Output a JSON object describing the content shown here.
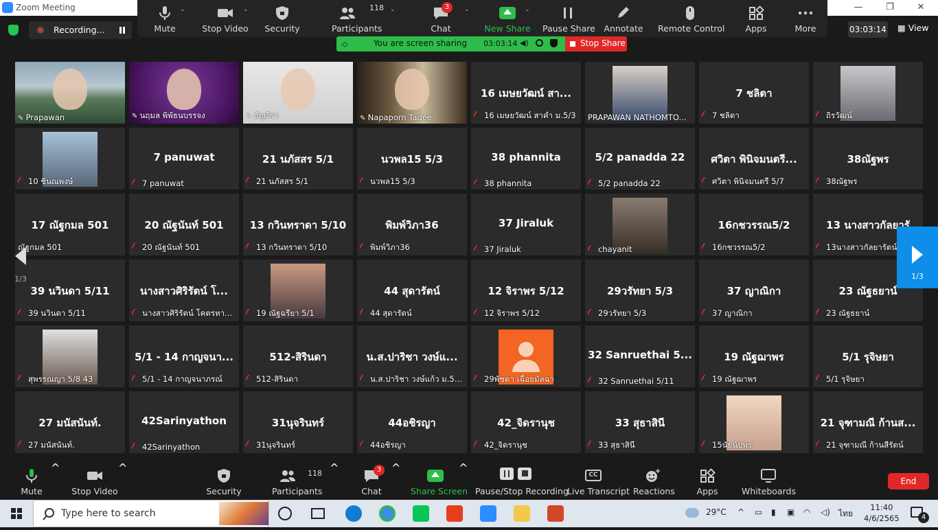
{
  "window": {
    "title": "Zoom Meeting",
    "minimize": "—",
    "maximize": "❐",
    "close": "✕"
  },
  "recording": {
    "label": "Recording..."
  },
  "share_toolbar": {
    "mute": "Mute",
    "stop_video": "Stop Video",
    "security": "Security",
    "participants": "Participants",
    "participants_count": "118",
    "chat": "Chat",
    "chat_badge": "3",
    "new_share": "New Share",
    "pause_share": "Pause Share",
    "annotate": "Annotate",
    "remote_control": "Remote Control",
    "apps": "Apps",
    "more": "More"
  },
  "meeting_timer": "03:03:14",
  "view_label": "View",
  "sharing_banner": {
    "text": "You are screen sharing",
    "time": "03:03:14",
    "stop": "Stop Share"
  },
  "tiles": [
    {
      "big": "",
      "name": "Prapawan",
      "muted": false,
      "pinned": true,
      "photo": "p1"
    },
    {
      "big": "",
      "name": "นฤมล พิพัธนบรรจง",
      "muted": false,
      "pinned": true,
      "photo": "p2",
      "speaking": true
    },
    {
      "big": "",
      "name": "ธัญจิรา",
      "muted": false,
      "pinned": true,
      "photo": "p3"
    },
    {
      "big": "",
      "name": "Napaporn Tadee",
      "muted": false,
      "pinned": true,
      "photo": "p4"
    },
    {
      "big": "16 เมษยวัฒน์ สา...",
      "name": "16 เมษยวัฒน์ สาคำ ม.5/3",
      "muted": true
    },
    {
      "big": "",
      "name": "PRAPAWAN NATHOMTO...",
      "muted": false,
      "avatar": "a1"
    },
    {
      "big": "7 ชลิตา",
      "name": "7 ชลิตา",
      "muted": true
    },
    {
      "big": "",
      "name": "ถิรวัฒน์",
      "muted": true,
      "avatar": "a2"
    },
    {
      "big": "",
      "name": "10 ชินณพงษ์",
      "muted": true,
      "avatar": "a3"
    },
    {
      "big": "7 panuwat",
      "name": "7 panuwat",
      "muted": true
    },
    {
      "big": "21 นภัสสร 5/1",
      "name": "21 นภัสสร 5/1",
      "muted": true
    },
    {
      "big": "นวพล15 5/3",
      "name": "นวพล15 5/3",
      "muted": true
    },
    {
      "big": "38 phannita",
      "name": "38 phannita",
      "muted": true
    },
    {
      "big": "5/2 panadda 22",
      "name": "5/2 panadda 22",
      "muted": true
    },
    {
      "big": "ศวิตา พินิจมนตรี...",
      "name": "ศวิตา พินิจมนตรี 5/7",
      "muted": true
    },
    {
      "big": "38ณัฐพร",
      "name": "38ณัฐพร",
      "muted": true
    },
    {
      "big": "17 ณัฐกมล 501",
      "name": "ณัฐกมล 501",
      "muted": false
    },
    {
      "big": "20 ณัฐนันท์ 501",
      "name": "20 ณัฐนันท์ 501",
      "muted": true
    },
    {
      "big": "13 กวินทราดา 5/10",
      "name": "13 กวินทราดา 5/10",
      "muted": true
    },
    {
      "big": "พิมพ์วิภา36",
      "name": "พิมพ์วิภา36",
      "muted": true
    },
    {
      "big": "37 Jiraluk",
      "name": "37 Jiraluk",
      "muted": true
    },
    {
      "big": "",
      "name": "chayanit",
      "muted": true,
      "avatar": "a4"
    },
    {
      "big": "16กชวรรณ5/2",
      "name": "16กชวรรณ5/2",
      "muted": true
    },
    {
      "big": "13 นางสาวกัลยารั",
      "name": "13นางสาวกัลยารัตน์",
      "muted": true
    },
    {
      "big": "39 นวินดา 5/11",
      "name": "39 นวินดา 5/11",
      "muted": true
    },
    {
      "big": "นางสาวศิริรัตน์ โ...",
      "name": "นางสาวศิริรัตน์ โคตรหา...",
      "muted": true
    },
    {
      "big": "",
      "name": "19 ณัฐฉรียา 5/1",
      "muted": true,
      "avatar": "a5"
    },
    {
      "big": "44 สุดารัตน์",
      "name": "44 สุดารัตน์",
      "muted": true
    },
    {
      "big": "12 จิราพร 5/12",
      "name": "12 จิราพร 5/12",
      "muted": true
    },
    {
      "big": "29วรัทยา 5/3",
      "name": "29วรัทยา 5/3",
      "muted": true
    },
    {
      "big": "37 ญาณิกา",
      "name": "37 ญาณิกา",
      "muted": true
    },
    {
      "big": "23 ณัฐธยาน์",
      "name": "23 ณัฐธยาน์",
      "muted": true
    },
    {
      "big": "",
      "name": "สุพรรณญา 5/8 43",
      "muted": true,
      "avatar": "a6"
    },
    {
      "big": "5/1 - 14 กาญจนา...",
      "name": "5/1 - 14 กาญจนาภรณ์",
      "muted": true
    },
    {
      "big": "512-สิรินดา",
      "name": "512-สิรินดา",
      "muted": true
    },
    {
      "big": "น.ส.ปาริชา วงษ์แ...",
      "name": "น.ส.ปาริชา วงษ์แก้ว ม.5/...",
      "muted": true
    },
    {
      "big": "",
      "name": "29พัชดา เฉื่อยมัลฉา",
      "muted": true,
      "avatar": "a7"
    },
    {
      "big": "32 Sanruethai 5...",
      "name": "32 Sanruethai 5/11",
      "muted": true
    },
    {
      "big": "19 ณัฐฌาพร",
      "name": "19 ณัฐฌาพร",
      "muted": true
    },
    {
      "big": "5/1 รุจิษยา",
      "name": "5/1 รุจิษยา",
      "muted": true
    },
    {
      "big": "27 มนัสนันท์.",
      "name": "27 มนัสนันท์.",
      "muted": true
    },
    {
      "big": "42Sarinyathon",
      "name": "42Sarinyathon",
      "muted": true
    },
    {
      "big": "31นุจรินทร์",
      "name": "31นุจรินทร์",
      "muted": true
    },
    {
      "big": "44อชิรญา",
      "name": "44อชิรญา",
      "muted": true
    },
    {
      "big": "42_จิดรานุช",
      "name": "42_จิดรานุช",
      "muted": true
    },
    {
      "big": "33 สุธาสินี",
      "name": "33 สุธาสินี",
      "muted": true
    },
    {
      "big": "",
      "name": "15นัยน์ปพร",
      "muted": true,
      "avatar": "a8"
    },
    {
      "big": "21 จุฑามณี ก้านส...",
      "name": "21 จุฑามณี ก้านสีรัตน์",
      "muted": true
    }
  ],
  "pager": {
    "page": "1/3"
  },
  "bottom_bar": {
    "mute": "Mute",
    "stop_video": "Stop Video",
    "security": "Security",
    "participants": "Participants",
    "participants_count": "118",
    "chat": "Chat",
    "chat_badge": "3",
    "share_screen": "Share Screen",
    "pause_recording": "Pause/Stop Recording",
    "live_transcript": "Live Transcript",
    "reactions": "Reactions",
    "apps": "Apps",
    "whiteboards": "Whiteboards",
    "end": "End"
  },
  "taskbar": {
    "search_placeholder": "Type here to search",
    "temperature": "29°C",
    "language": "ไทย",
    "time": "11:40",
    "date": "4/6/2565",
    "notification_count": "4"
  }
}
